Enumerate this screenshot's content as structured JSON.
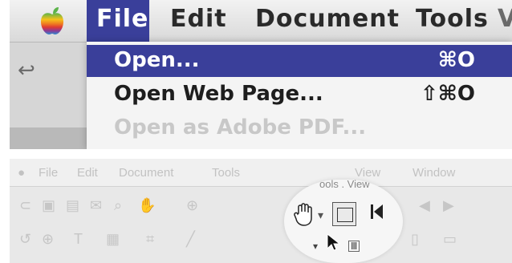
{
  "top_menu": {
    "titles": [
      "File",
      "Edit",
      "Document",
      "Tools",
      "Vi"
    ],
    "active": "File"
  },
  "file_menu": {
    "items": [
      {
        "label": "Open...",
        "shortcut": "⌘O",
        "state": "highlighted"
      },
      {
        "label": "Open Web Page...",
        "shortcut": "⇧⌘O",
        "state": "normal"
      },
      {
        "label": "Open as Adobe PDF...",
        "shortcut": "",
        "state": "disabled"
      }
    ]
  },
  "bottom_menu": {
    "titles": [
      "File",
      "Edit",
      "Document",
      "Tools",
      "View",
      "Window"
    ]
  },
  "magnifier": {
    "label": "Ⅲ"
  },
  "colors": {
    "highlight": "#3a3f9a",
    "menubar": "#e6e6e6",
    "disabled_text": "#c8c8c8"
  }
}
